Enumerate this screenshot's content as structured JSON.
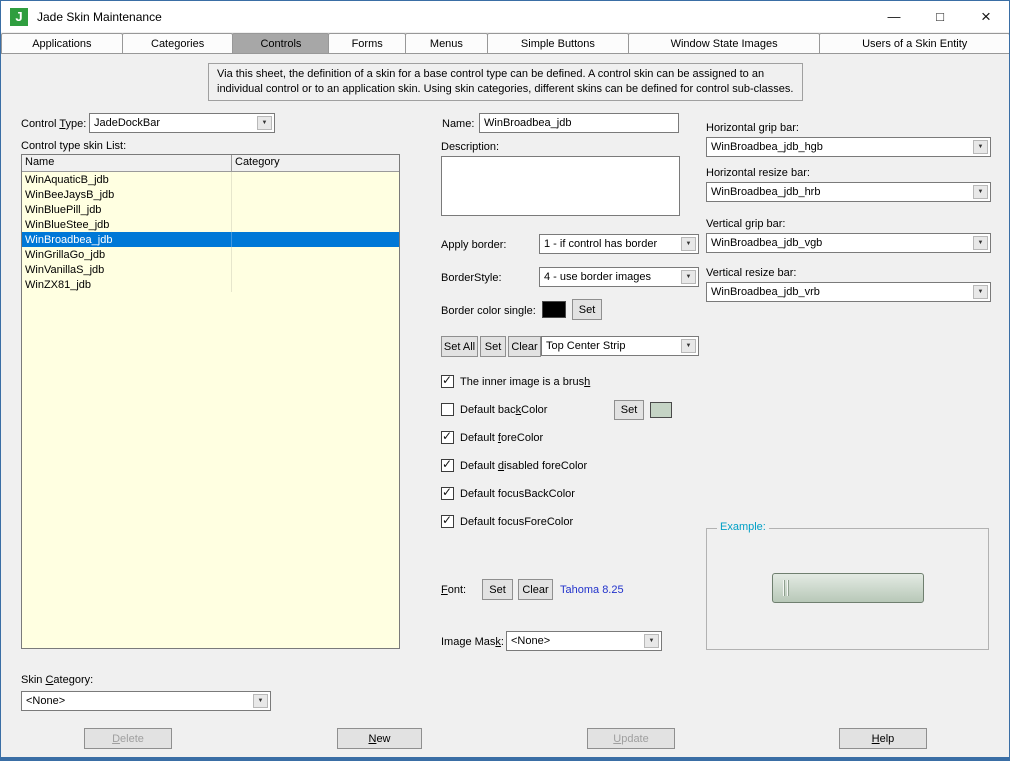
{
  "window": {
    "title": "Jade Skin Maintenance",
    "icon_letter": "J",
    "controls": {
      "minimize": "—",
      "maximize": "□",
      "close": "×"
    }
  },
  "icons": {
    "chevron_down": "▼"
  },
  "tabs": [
    {
      "label": "Applications",
      "selected": false
    },
    {
      "label": "Categories",
      "selected": false
    },
    {
      "label": "Controls",
      "selected": true
    },
    {
      "label": "Forms",
      "selected": false
    },
    {
      "label": "Menus",
      "selected": false
    },
    {
      "label": "Simple Buttons",
      "selected": false
    },
    {
      "label": "Window State Images",
      "selected": false
    },
    {
      "label": "Users of a Skin Entity",
      "selected": false
    }
  ],
  "info_text": "Via this sheet, the definition of a skin for a base control type can be defined. A control skin can be assigned to an individual control or to an application skin. Using skin categories, different skins can be defined for control sub-classes.",
  "control_type": {
    "label_html": "Control <u>T</u>ype:",
    "value": "JadeDockBar"
  },
  "skin_list": {
    "label": "Control type skin List:",
    "columns": [
      "Name",
      "Category"
    ],
    "rows": [
      {
        "name": "WinAquaticB_jdb",
        "category": "",
        "selected": false
      },
      {
        "name": "WinBeeJaysB_jdb",
        "category": "",
        "selected": false
      },
      {
        "name": "WinBluePill_jdb",
        "category": "",
        "selected": false
      },
      {
        "name": "WinBlueStee_jdb",
        "category": "",
        "selected": false
      },
      {
        "name": "WinBroadbea_jdb",
        "category": "",
        "selected": true
      },
      {
        "name": "WinGrillaGo_jdb",
        "category": "",
        "selected": false
      },
      {
        "name": "WinVanillaS_jdb",
        "category": "",
        "selected": false
      },
      {
        "name": "WinZX81_jdb",
        "category": "",
        "selected": false
      }
    ]
  },
  "skin_category": {
    "label_html": "Skin <u>C</u>ategory:",
    "value": "<None>"
  },
  "detail": {
    "name_label": "Name:",
    "name_value": "WinBroadbea_jdb",
    "description_label": "Description:",
    "description_value": "",
    "apply_border_label": "Apply border:",
    "apply_border_value": "1 - if control has border",
    "border_style_label": "BorderStyle:",
    "border_style_value": "4 - use border images",
    "border_color_label": "Border color single:",
    "border_color_value": "#000000",
    "border_color_set": "Set",
    "strip_set_all": "Set All",
    "strip_set": "Set",
    "strip_clear": "Clear",
    "strip_value": "Top Center Strip",
    "checkboxes": [
      {
        "label_html": "The inner image is a brus<u>h</u>",
        "checked": true
      },
      {
        "label_html": "Default bac<u>k</u>Color",
        "checked": false
      },
      {
        "label_html": "Default <u>f</u>oreColor",
        "checked": true
      },
      {
        "label_html": "Default <u>d</u>isabled foreColor",
        "checked": true
      },
      {
        "label_html": "Default focusBackColor",
        "checked": true
      },
      {
        "label_html": "Default focusForeColor",
        "checked": true
      }
    ],
    "back_color_set": "Set",
    "back_color_swatch": "#c5d4c5",
    "font_label_html": "<u>F</u>ont:",
    "font_set": "Set",
    "font_clear": "Clear",
    "font_value": "Tahoma 8.25",
    "image_mask_label_html": "Image Mas<u>k</u>:",
    "image_mask_value": "<None>"
  },
  "bars": [
    {
      "label": "Horizontal grip bar:",
      "value": "WinBroadbea_jdb_hgb"
    },
    {
      "label": "Horizontal resize bar:",
      "value": "WinBroadbea_jdb_hrb"
    },
    {
      "label": "Vertical grip bar:",
      "value": "WinBroadbea_jdb_vgb"
    },
    {
      "label": "Vertical resize bar:",
      "value": "WinBroadbea_jdb_vrb"
    }
  ],
  "example": {
    "label": "Example:"
  },
  "footer": [
    {
      "label_html": "<u>D</u>elete",
      "disabled": true
    },
    {
      "label_html": "<u>N</u>ew",
      "disabled": false
    },
    {
      "label_html": "<u>U</u>pdate",
      "disabled": true
    },
    {
      "label_html": "<u>H</u>elp",
      "disabled": false
    }
  ],
  "colors": {
    "window_border": "#3a6ea5",
    "selection": "#0078d7",
    "list_background": "#ffffe1",
    "example_label": "#00a0c6",
    "font_value_text": "#2233cc"
  }
}
